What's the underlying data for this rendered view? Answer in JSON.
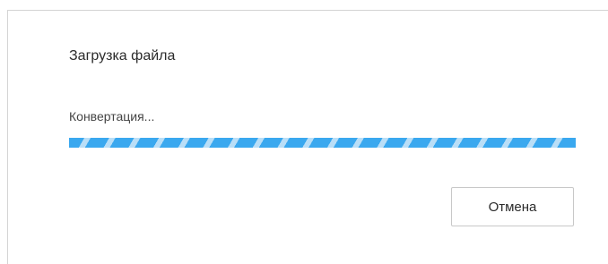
{
  "dialog": {
    "title": "Загрузка файла",
    "status": "Конвертация...",
    "progress": {
      "indeterminate": true,
      "fill_fraction": 1.0,
      "color": "#3aa8ef",
      "stripe_color": "#b9def7"
    },
    "cancel_label": "Отмена"
  }
}
